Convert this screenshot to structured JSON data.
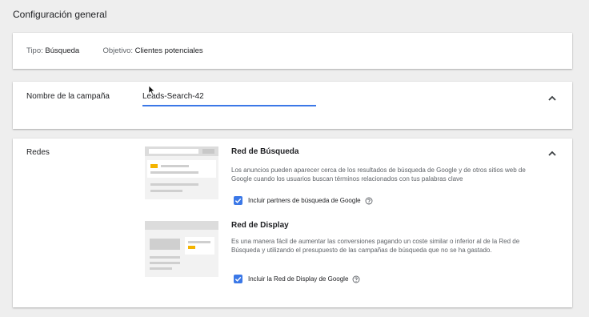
{
  "page": {
    "section_title": "Configuración general"
  },
  "summary": {
    "tipo_label": "Tipo:",
    "tipo_value": "Búsqueda",
    "objetivo_label": "Objetivo:",
    "objetivo_value": "Clientes potenciales"
  },
  "campaign_name": {
    "label": "Nombre de la campaña",
    "value": "Leads-Search-42"
  },
  "redes": {
    "label": "Redes",
    "busqueda": {
      "title": "Red de Búsqueda",
      "description": "Los anuncios pueden aparecer cerca de los resultados de búsqueda de Google y de otros sitios web de Google cuando los usuarios buscan términos relacionados con tus palabras clave",
      "checkbox_label": "Incluir partners de búsqueda de Google",
      "checked": true
    },
    "display": {
      "title": "Red de Display",
      "description": "Es una manera fácil de aumentar las conversiones pagando un coste similar o inferior al de la Red de Búsqueda y utilizando el presupuesto de las campañas de búsqueda que no se ha gastado.",
      "checkbox_label": "Incluir la Red de Display de Google",
      "checked": true
    }
  },
  "icons": {
    "collapse": "chevron-up-icon",
    "check": "check-icon",
    "help": "help-circle-icon",
    "cursor": "mouse-pointer-icon"
  },
  "colors": {
    "accent": "#3b78e7",
    "highlight": "#f4b400",
    "background": "#eeeeee"
  }
}
